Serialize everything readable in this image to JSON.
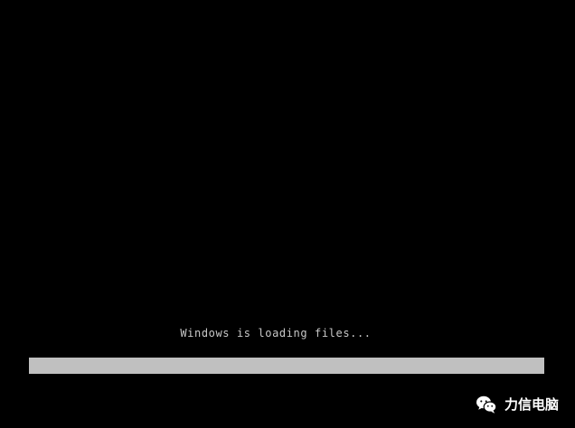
{
  "setup": {
    "status_text": "Windows is loading files...",
    "progress_fraction": 1.0
  },
  "watermark": {
    "icon": "wechat-icon",
    "text": "力信电脑"
  },
  "colors": {
    "background": "#000000",
    "text": "#c8c8c8",
    "progress_fill": "#c0c0c0",
    "watermark_text": "#ffffff"
  }
}
